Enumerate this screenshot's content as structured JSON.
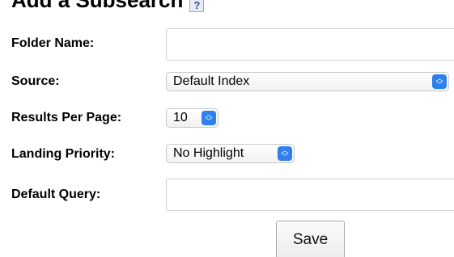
{
  "form": {
    "title": "Add a Subsearch",
    "help_icon": "help-icon",
    "help_glyph": "?",
    "fields": {
      "folder_name": {
        "label": "Folder Name:",
        "value": ""
      },
      "source": {
        "label": "Source:",
        "selected": "Default Index"
      },
      "results_per_page": {
        "label": "Results Per Page:",
        "selected": "10"
      },
      "landing_priority": {
        "label": "Landing Priority:",
        "selected": "No Highlight"
      },
      "default_query": {
        "label": "Default Query:",
        "value": ""
      }
    },
    "save_label": "Save"
  },
  "icons": {
    "select_arrows": "up-down-chevron-icon"
  },
  "colors": {
    "select_accent": "#2f80ed"
  }
}
